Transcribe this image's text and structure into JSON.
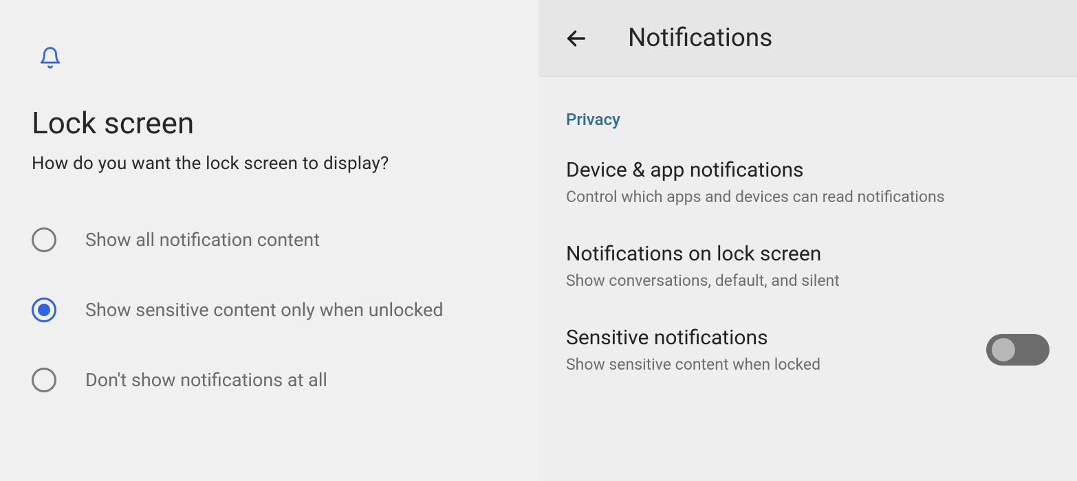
{
  "left": {
    "title": "Lock screen",
    "subtitle": "How do you want the lock screen to display?",
    "options": [
      {
        "label": "Show all notification content",
        "selected": false
      },
      {
        "label": "Show sensitive content only when unlocked",
        "selected": true
      },
      {
        "label": "Don't show notifications at all",
        "selected": false
      }
    ]
  },
  "right": {
    "appbar_title": "Notifications",
    "section": "Privacy",
    "items": [
      {
        "title": "Device & app notifications",
        "desc": "Control which apps and devices can read notifications"
      },
      {
        "title": "Notifications on lock screen",
        "desc": "Show conversations, default, and silent"
      },
      {
        "title": "Sensitive notifications",
        "desc": "Show sensitive content when locked",
        "toggle": false
      }
    ]
  }
}
